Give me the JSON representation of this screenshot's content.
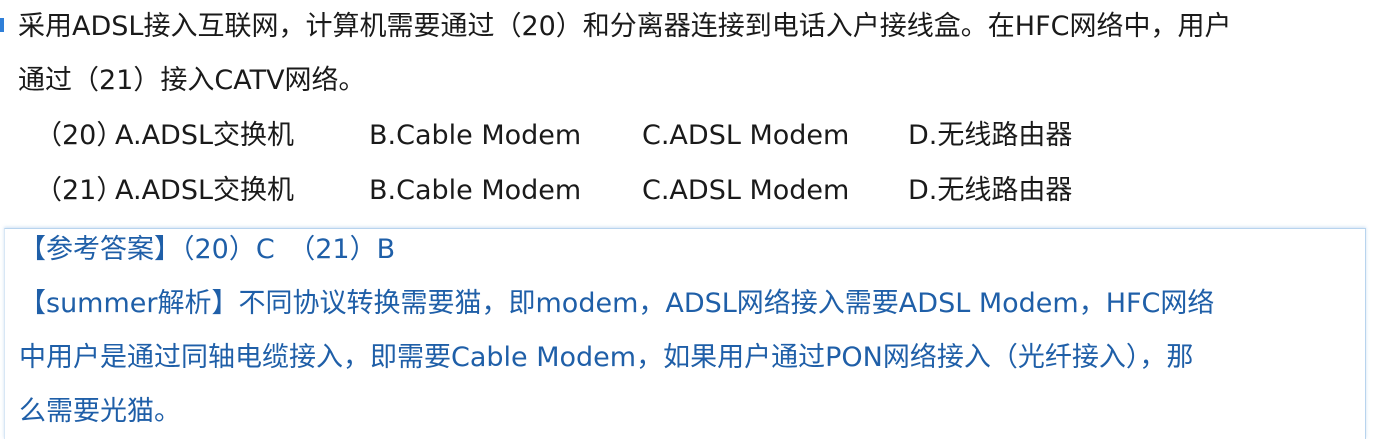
{
  "question": {
    "line1": "采用ADSL接入互联网，计算机需要通过（20）和分离器连接到电话入户接线盒。在HFC网络中，用户",
    "line2": "通过（21）接入CATV网络。",
    "options": [
      {
        "number": "（20）",
        "a": "A.ADSL交换机",
        "b": "B.Cable Modem",
        "c": "C.ADSL Modem",
        "d": "D.无线路由器"
      },
      {
        "number": "（21）",
        "a": "A.ADSL交换机",
        "b": "B.Cable Modem",
        "c": "C.ADSL Modem",
        "d": "D.无线路由器"
      }
    ]
  },
  "answer": {
    "reference": "【参考答案】（20）C　（21）B",
    "analysis_line1": "【summer解析】不同协议转换需要猫，即modem，ADSL网络接入需要ADSL Modem，HFC网络",
    "analysis_line2": "中用户是通过同轴电缆接入，即需要Cable Modem，如果用户通过PON网络接入（光纤接入），那",
    "analysis_line3": "么需要光猫。"
  },
  "colors": {
    "question_text": "#1a1a1a",
    "answer_text": "#1f5fa8",
    "accent": "#2f7fd8",
    "box_border": "#b8d4ee"
  }
}
